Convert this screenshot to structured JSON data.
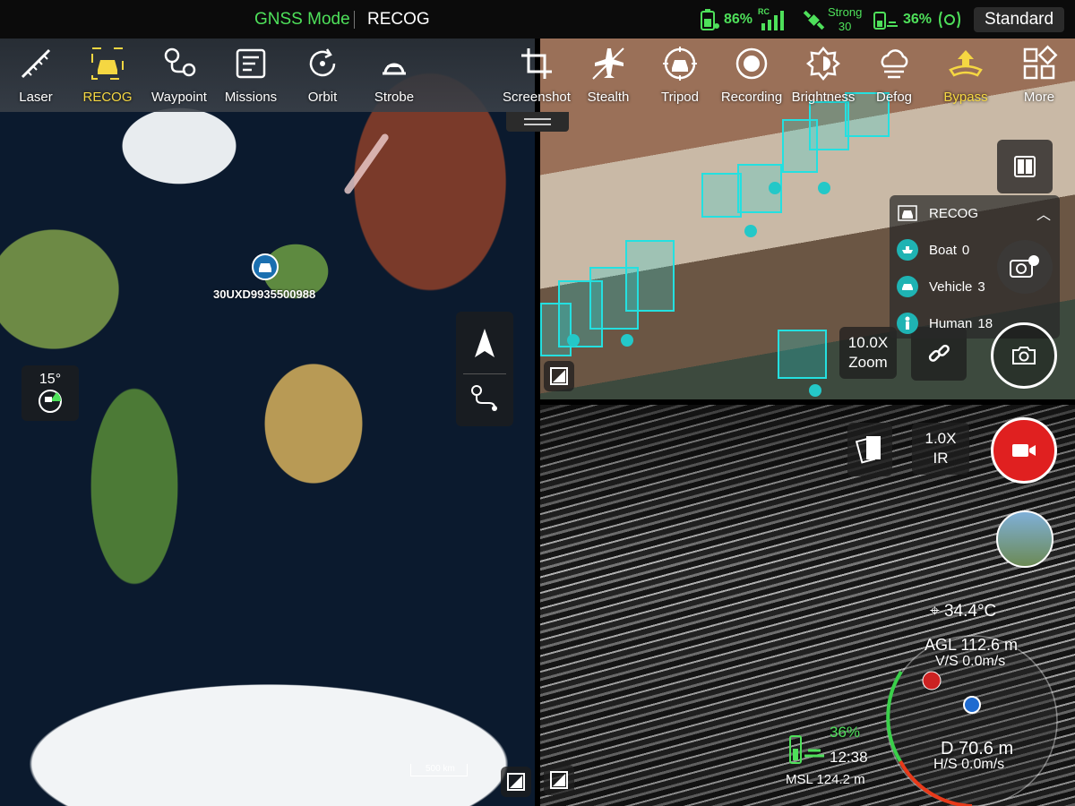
{
  "status_bar": {
    "mode": "GNSS Mode",
    "task": "RECOG",
    "aircraft_battery": "86%",
    "rc_label": "RC",
    "gps_strength": "Strong",
    "gps_count": "30",
    "rc_battery": "36%",
    "profile": "Standard",
    "accent_color": "#4ee05a"
  },
  "toolbar_left": [
    {
      "label": "Laser",
      "icon": "laser-ruler-icon"
    },
    {
      "label": "RECOG",
      "icon": "recog-car-icon",
      "active": true
    },
    {
      "label": "Waypoint",
      "icon": "waypoint-icon"
    },
    {
      "label": "Missions",
      "icon": "missions-icon"
    },
    {
      "label": "Orbit",
      "icon": "orbit-icon"
    },
    {
      "label": "Strobe",
      "icon": "strobe-icon"
    }
  ],
  "toolbar_right": [
    {
      "label": "Screenshot",
      "icon": "crop-icon"
    },
    {
      "label": "Stealth",
      "icon": "stealth-icon"
    },
    {
      "label": "Tripod",
      "icon": "tripod-icon"
    },
    {
      "label": "Recording",
      "icon": "record-icon"
    },
    {
      "label": "Brightness",
      "icon": "brightness-icon"
    },
    {
      "label": "Defog",
      "icon": "defog-icon"
    },
    {
      "label": "Bypass",
      "icon": "bypass-icon",
      "active": true
    },
    {
      "label": "More",
      "icon": "more-grid-icon"
    }
  ],
  "map": {
    "aircraft_label": "30UXD9935500988",
    "scale_label": "500 km",
    "gimbal_angle": "15°"
  },
  "zoom_camera": {
    "zoom_value": "10.0X",
    "zoom_label": "Zoom"
  },
  "recog_panel": {
    "title": "RECOG",
    "rows": [
      {
        "name": "Boat",
        "count": "0",
        "icon": "boat-icon"
      },
      {
        "name": "Vehicle",
        "count": "3",
        "icon": "vehicle-icon"
      },
      {
        "name": "Human",
        "count": "18",
        "icon": "human-icon"
      }
    ]
  },
  "ir_camera": {
    "zoom_value": "1.0X",
    "zoom_label": "IR",
    "temperature": "34.4°C"
  },
  "telemetry": {
    "agl": "AGL 112.6 m",
    "vs": "V/S 0.0m/s",
    "distance": "D 70.6 m",
    "hs": "H/S 0.0m/s",
    "battery_pct": "36%",
    "battery_time": "12:38",
    "msl": "MSL 124.2 m"
  }
}
